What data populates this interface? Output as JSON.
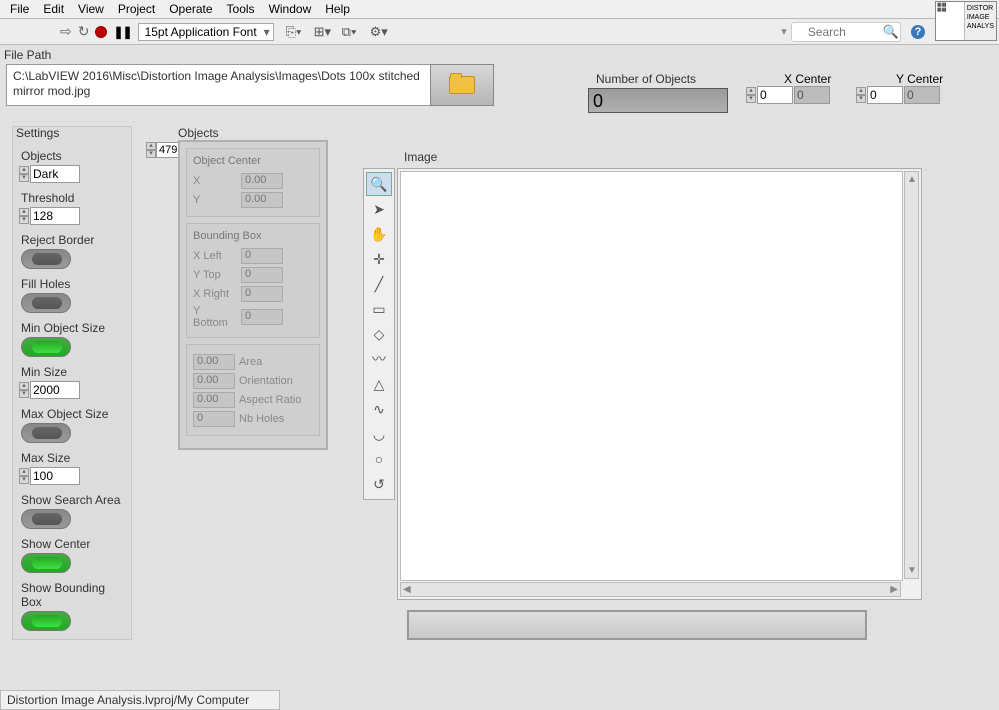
{
  "menu": [
    "File",
    "Edit",
    "View",
    "Project",
    "Operate",
    "Tools",
    "Window",
    "Help"
  ],
  "toolbar": {
    "font": "15pt Application Font",
    "search_placeholder": "Search"
  },
  "thumb": {
    "label": "DISTOR IMAGE ANALYS"
  },
  "filepath": {
    "label": "File Path",
    "value": "C:\\LabVIEW 2016\\Misc\\Distortion Image Analysis\\Images\\Dots 100x stitched mirror mod.jpg"
  },
  "num_objects": {
    "label": "Number of Objects",
    "value": "0"
  },
  "xcenter": {
    "label": "X Center",
    "v1": "0",
    "v2": "0"
  },
  "ycenter": {
    "label": "Y Center",
    "v1": "0",
    "v2": "0"
  },
  "settings": {
    "title": "Settings",
    "objects_label": "Objects",
    "objects_value": "Dark",
    "threshold_label": "Threshold",
    "threshold_value": "128",
    "reject_border": "Reject Border",
    "fill_holes": "Fill Holes",
    "min_obj_size": "Min Object Size",
    "min_size_label": "Min Size",
    "min_size_value": "2000",
    "max_obj_size": "Max Object Size",
    "max_size_label": "Max Size",
    "max_size_value": "100",
    "show_search": "Show Search Area",
    "show_center": "Show Center",
    "show_bbox": "Show Bounding Box"
  },
  "objects_section": {
    "label": "Objects",
    "index": "479",
    "center_title": "Object Center",
    "x": "X",
    "x_val": "0.00",
    "y": "Y",
    "y_val": "0.00",
    "bbox_title": "Bounding Box",
    "xleft": "X Left",
    "xleft_val": "0",
    "ytop": "Y Top",
    "ytop_val": "0",
    "xright": "X Right",
    "xright_val": "0",
    "ybottom": "Y Bottom",
    "ybottom_val": "0",
    "area_lbl": "Area",
    "area_val": "0.00",
    "orient_lbl": "Orientation",
    "orient_val": "0.00",
    "aspect_lbl": "Aspect Ratio",
    "aspect_val": "0.00",
    "holes_lbl": "Nb Holes",
    "holes_val": "0"
  },
  "image_label": "Image",
  "statusbar": "Distortion Image Analysis.lvproj/My Computer"
}
